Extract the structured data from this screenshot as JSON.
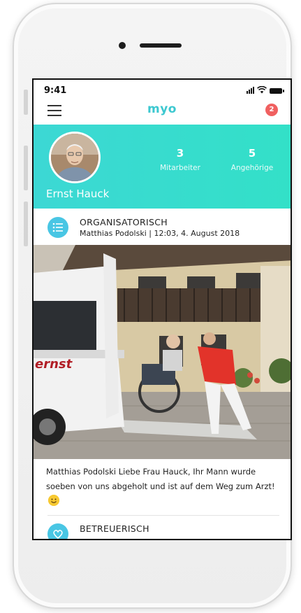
{
  "status_bar": {
    "time": "9:41",
    "icons": [
      "signal-icon",
      "wifi-icon",
      "battery-icon"
    ]
  },
  "header": {
    "app_title": "myo",
    "notification_count": "2",
    "menu_icon": "hamburger-menu-icon"
  },
  "profile": {
    "name": "Ernst Hauck",
    "stats": [
      {
        "value": "3",
        "label": "Mitarbeiter"
      },
      {
        "value": "5",
        "label": "Angehörige"
      }
    ],
    "banner_color": "#3cd8d4"
  },
  "feed": {
    "items": [
      {
        "category": "ORGANISATORISCH",
        "meta": "Matthias Podolski | 12:03, 4. August 2018",
        "icon": "checklist-icon",
        "van_lettering": "ernst",
        "text": "Matthias Podolski Liebe Frau Hauck, Ihr Mann wurde soeben von uns abgeholt und ist auf dem Weg zum Arzt!"
      },
      {
        "category": "BETREUERISCH",
        "icon": "heart-icon"
      }
    ]
  },
  "colors": {
    "accent": "#3cc8d0",
    "badge": "#f06060",
    "category_icon": "#49c6e4"
  }
}
